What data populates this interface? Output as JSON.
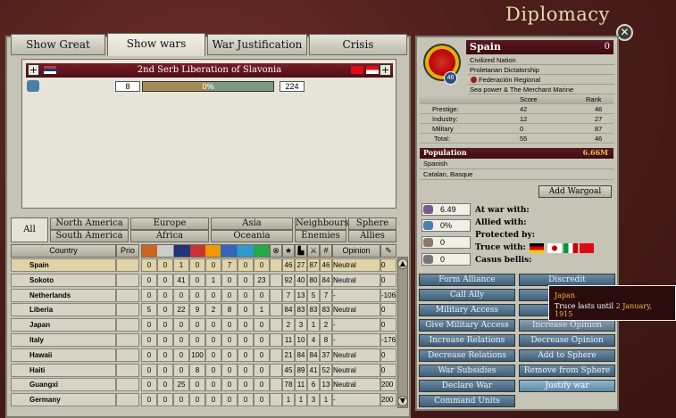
{
  "window": {
    "title": "Diplomacy",
    "close_icon": "close-icon"
  },
  "tabs": [
    {
      "label": "Show Great Powers"
    },
    {
      "label": "Show wars"
    },
    {
      "label": "War Justification"
    },
    {
      "label": "Crisis"
    }
  ],
  "war": {
    "name": "2nd Serb Liberation of Slavonia",
    "attacker_strength": "8",
    "progress": "0%",
    "progress_value": 0,
    "defender_strength": "224"
  },
  "filters": {
    "all": "All",
    "north_america": "North America",
    "south_america": "South America",
    "europe": "Europe",
    "africa": "Africa",
    "asia": "Asia",
    "oceania": "Oceania",
    "neighbours": "Neighbours",
    "enemies": "Enemies",
    "sphere": "Sphere",
    "allies": "Allies"
  },
  "table": {
    "header": {
      "country": "Country",
      "prio": "Prio",
      "opinion": "Opinion"
    },
    "rows": [
      {
        "name": "Spain",
        "c": [
          "0",
          "0",
          "1",
          "0",
          "0",
          "7",
          "0",
          "0",
          "46",
          "27",
          "87",
          "46"
        ],
        "opinion": "Neutral",
        "last": "0"
      },
      {
        "name": "Sokoto",
        "c": [
          "0",
          "0",
          "41",
          "0",
          "1",
          "0",
          "0",
          "23",
          "92",
          "40",
          "80",
          "84"
        ],
        "opinion": "Neutral",
        "last": "0"
      },
      {
        "name": "Netherlands",
        "c": [
          "0",
          "0",
          "0",
          "0",
          "0",
          "0",
          "0",
          "0",
          "7",
          "13",
          "5",
          "7"
        ],
        "opinion": "-",
        "last": "-106"
      },
      {
        "name": "Liberia",
        "c": [
          "5",
          "0",
          "22",
          "9",
          "2",
          "8",
          "0",
          "1",
          "84",
          "83",
          "83",
          "83"
        ],
        "opinion": "Neutral",
        "last": "0"
      },
      {
        "name": "Japan",
        "c": [
          "0",
          "0",
          "0",
          "0",
          "0",
          "0",
          "0",
          "0",
          "2",
          "3",
          "1",
          "2"
        ],
        "opinion": "-",
        "last": "0"
      },
      {
        "name": "Italy",
        "c": [
          "0",
          "0",
          "0",
          "0",
          "0",
          "0",
          "0",
          "0",
          "11",
          "10",
          "4",
          "8"
        ],
        "opinion": "-",
        "last": "-176"
      },
      {
        "name": "Hawaii",
        "c": [
          "0",
          "0",
          "0",
          "100",
          "0",
          "0",
          "0",
          "0",
          "21",
          "84",
          "84",
          "37"
        ],
        "opinion": "Neutral",
        "last": "0"
      },
      {
        "name": "Haiti",
        "c": [
          "0",
          "0",
          "0",
          "8",
          "0",
          "0",
          "0",
          "0",
          "45",
          "89",
          "41",
          "52"
        ],
        "opinion": "Neutral",
        "last": "0"
      },
      {
        "name": "Guangxi",
        "c": [
          "0",
          "0",
          "25",
          "0",
          "0",
          "0",
          "0",
          "0",
          "78",
          "11",
          "6",
          "13"
        ],
        "opinion": "Neutral",
        "last": "200"
      },
      {
        "name": "Germany",
        "c": [
          "0",
          "0",
          "0",
          "0",
          "0",
          "0",
          "0",
          "0",
          "1",
          "1",
          "3",
          "1"
        ],
        "opinion": "-",
        "last": "200"
      }
    ]
  },
  "country": {
    "name": "Spain",
    "badge": "0",
    "rank": "46",
    "lines": [
      "Civilized Nation",
      "Proletarian Dictatorship",
      "Federación Regional",
      "Sea power & The Merchant Marine"
    ]
  },
  "scores": {
    "score_label": "Score",
    "rank_label": "Rank",
    "rows": [
      {
        "label": "Prestige:",
        "score": "42",
        "rank": "46"
      },
      {
        "label": "Industry:",
        "score": "12",
        "rank": "27"
      },
      {
        "label": "Military",
        "score": "0",
        "rank": "87"
      },
      {
        "label": "Total:",
        "score": "55",
        "rank": "46"
      }
    ]
  },
  "population": {
    "label": "Population",
    "value": "6.66M",
    "cultures": [
      "Spanish",
      "Catalan, Basque"
    ]
  },
  "wargoal_button": "Add Wargoal",
  "stats": {
    "influence": "6.49",
    "infamy": "0%",
    "s3": "0",
    "s4": "0"
  },
  "relations": {
    "at_war": "At war with:",
    "allied": "Allied with:",
    "protected": "Protected by:",
    "truce": "Truce with:",
    "casus": "Casus bellis:"
  },
  "actions": {
    "form_alliance": "Form Alliance",
    "discredit": "Discredit",
    "call_ally": "Call Ally",
    "expel": "Expel",
    "military_access": "Military Access",
    "ban": "Ban",
    "give_military_access": "Give Military Access",
    "increase_opinion": "Increase Opinion",
    "increase_relations": "Increase Relations",
    "decrease_opinion": "Decrease Opinion",
    "decrease_relations": "Decrease Relations",
    "add_to_sphere": "Add to Sphere",
    "war_subsidies": "War Subsidies",
    "remove_from_sphere": "Remove from Sphere",
    "declare_war": "Declare War",
    "justify_war": "Justify war",
    "command_units": "Command Units"
  },
  "tooltip": {
    "country": "Japan",
    "text": "Truce lasts until",
    "date": "2 January, 1915"
  }
}
